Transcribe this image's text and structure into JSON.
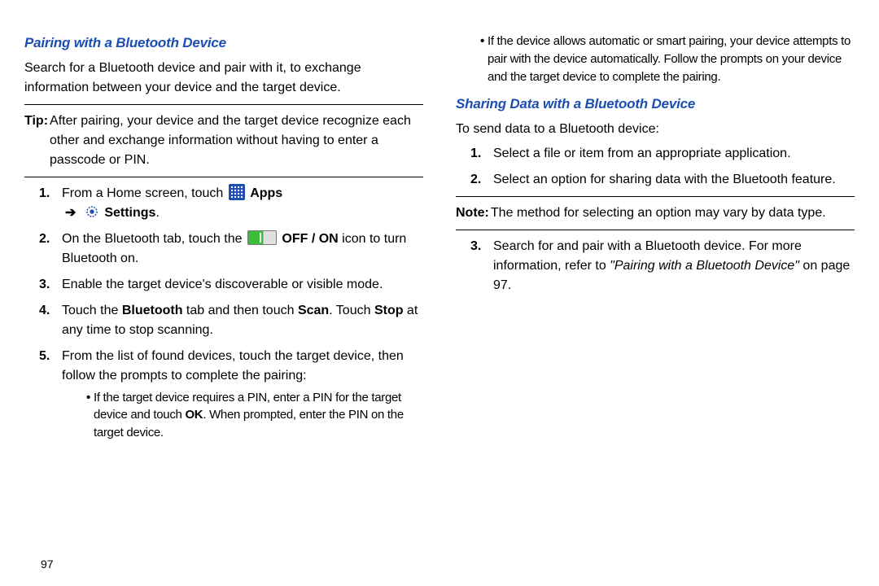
{
  "left": {
    "heading": "Pairing with a Bluetooth Device",
    "intro": "Search for a Bluetooth device and pair with it, to exchange information between your device and the target device.",
    "tip_label": "Tip:",
    "tip_text": "After pairing, your device and the target device recognize each other and exchange information without having to enter a passcode or PIN.",
    "step1_a": "From a Home screen, touch ",
    "apps_label": "Apps",
    "arrow": "➔",
    "settings_label": "Settings",
    "period": ".",
    "step2_a": "On the Bluetooth tab, touch the ",
    "off_on": "OFF / ON",
    "step2_b": " icon to turn Bluetooth on.",
    "step3": "Enable the target device's discoverable or visible mode.",
    "step4_a": "Touch the ",
    "bluetooth": "Bluetooth",
    "step4_b": " tab and then touch ",
    "scan": "Scan",
    "step4_c": ". Touch ",
    "stop": "Stop",
    "step4_d": " at any time to stop scanning.",
    "step5": "From the list of found devices, touch the target device, then follow the prompts to complete the pairing:",
    "bullet1_a": "If the target device requires a PIN, enter a PIN for the target device and touch ",
    "ok": "OK",
    "bullet1_b": ". When prompted, enter the PIN on the target device.",
    "pagenum": "97"
  },
  "right": {
    "bullet2": "If the device allows automatic or smart pairing, your device attempts to pair with the device automatically. Follow the prompts on your device and the target device to complete the pairing.",
    "heading": "Sharing Data with a Bluetooth Device",
    "intro": "To send data to a Bluetooth device:",
    "step1": "Select a file or item from an appropriate application.",
    "step2": "Select an option for sharing data with the Bluetooth feature.",
    "note_label": "Note:",
    "note_text": "The method for selecting an option may vary by data type.",
    "step3_a": "Search for and pair with a Bluetooth device. For more information, refer to ",
    "ref": "\"Pairing with a Bluetooth Device\"",
    "step3_b": " on page 97."
  }
}
